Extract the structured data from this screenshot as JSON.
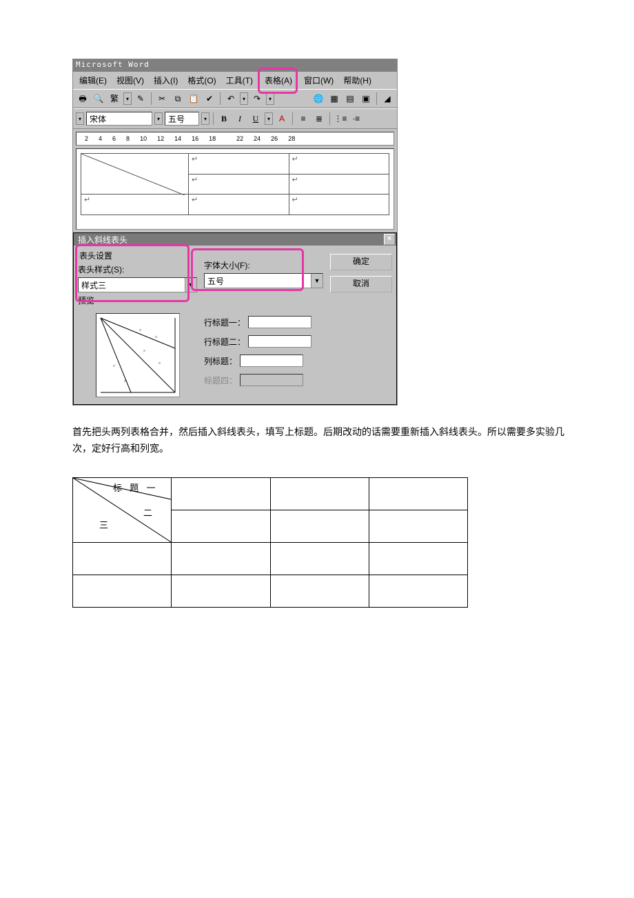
{
  "app": {
    "title": "Microsoft Word",
    "menus": [
      "编辑(E)",
      "视图(V)",
      "插入(I)",
      "格式(O)",
      "工具(T)",
      "表格(A)",
      "窗口(W)",
      "帮助(H)"
    ],
    "highlighted_menu_index": 5,
    "font_name": "宋体",
    "font_size": "五号",
    "bold": "B",
    "italic": "I",
    "underline": "U",
    "ruler_ticks": [
      "2",
      "4",
      "6",
      "8",
      "10",
      "12",
      "14",
      "16",
      "18",
      "",
      "22",
      "24",
      "26",
      "28"
    ]
  },
  "dialog": {
    "title": "插入斜线表头",
    "group_label": "表头设置",
    "style_label": "表头样式(S):",
    "style_value": "样式三",
    "fontsize_label": "字体大小(F):",
    "fontsize_value": "五号",
    "preview_label": "预览",
    "row_title1": "行标题一：",
    "row_title2": "行标题二：",
    "col_title": "列标题：",
    "title4": "标题四：",
    "ok": "确定",
    "cancel": "取消"
  },
  "explanation": "首先把头两列表格合并，然后插入斜线表头，填写上标题。后期改动的话需要重新插入斜线表头。所以需要多实验几次，定好行高和列宽。",
  "result": {
    "label1": "标 题 一",
    "label2": "二",
    "label3": "三"
  }
}
